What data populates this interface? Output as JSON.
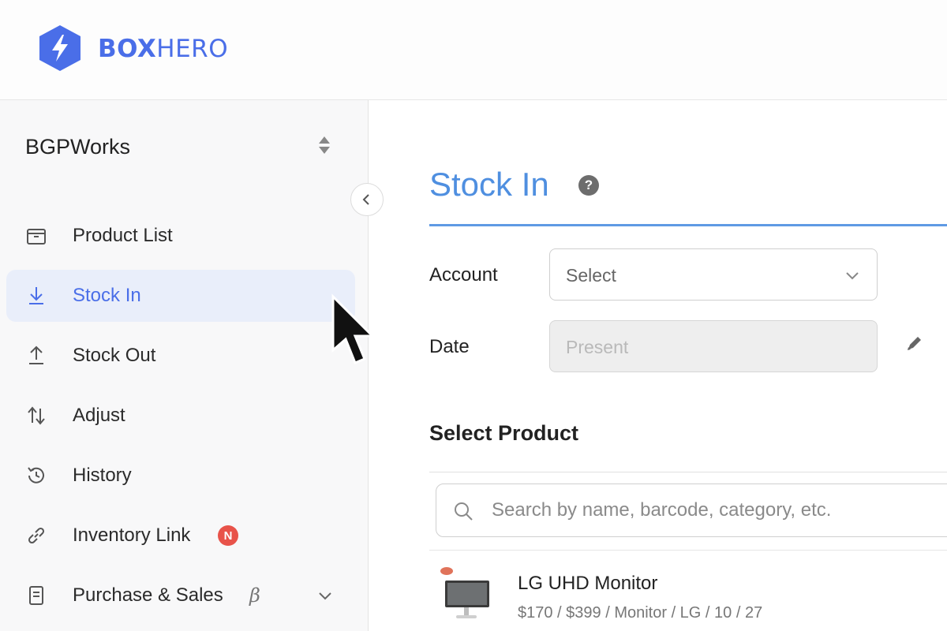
{
  "brand": {
    "name_bold": "BOX",
    "name_light": "HERO"
  },
  "sidebar": {
    "workspace": "BGPWorks",
    "items": [
      {
        "label": "Product List",
        "icon": "box-icon"
      },
      {
        "label": "Stock In",
        "icon": "arrow-down-icon",
        "active": true
      },
      {
        "label": "Stock Out",
        "icon": "arrow-up-icon"
      },
      {
        "label": "Adjust",
        "icon": "arrows-up-down-icon"
      },
      {
        "label": "History",
        "icon": "history-icon"
      },
      {
        "label": "Inventory Link",
        "icon": "link-icon",
        "badge": "N"
      },
      {
        "label": "Purchase & Sales",
        "icon": "document-icon",
        "suffix": "β"
      }
    ]
  },
  "main": {
    "title": "Stock In",
    "help": "?",
    "account": {
      "label": "Account",
      "placeholder": "Select"
    },
    "date": {
      "label": "Date",
      "placeholder": "Present"
    },
    "select_product": {
      "title": "Select Product",
      "search_placeholder": "Search by name, barcode, category, etc."
    },
    "products": [
      {
        "name": "LG UHD Monitor",
        "meta": "$170 / $399 / Monitor / LG / 10 / 27"
      }
    ]
  },
  "colors": {
    "accent": "#4a6ee8",
    "title_blue": "#4f8fe0",
    "active_bg": "#e9eefa",
    "badge_red": "#e8534a"
  }
}
